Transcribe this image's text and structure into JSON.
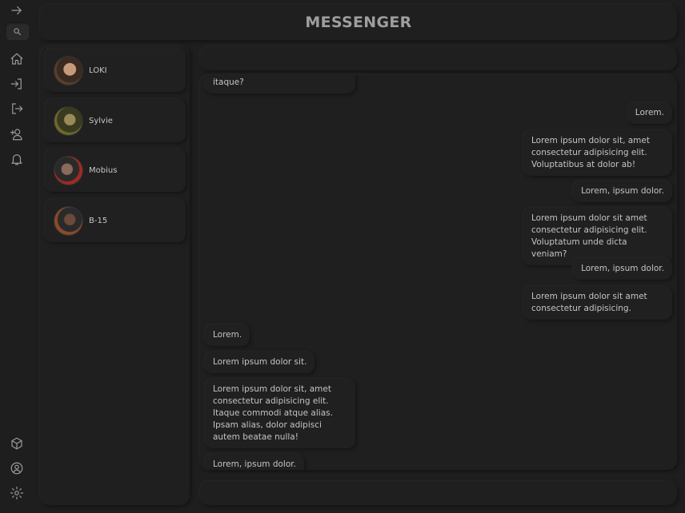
{
  "app": {
    "title": "MESSENGER"
  },
  "rail": {
    "icons": [
      "arrow-right-icon",
      "search-icon",
      "home-icon",
      "login-icon",
      "logout-icon",
      "add-user-icon",
      "bell-icon",
      "cube-icon",
      "user-circle-icon",
      "gear-icon"
    ]
  },
  "contacts": [
    {
      "name": "LOKI",
      "avatar_color": "#6b4a3a"
    },
    {
      "name": "Sylvie",
      "avatar_color": "#4a4a2a"
    },
    {
      "name": "Mobius",
      "avatar_color": "#5a2a22"
    },
    {
      "name": "B-15",
      "avatar_color": "#5a3a2a"
    }
  ],
  "messages": [
    {
      "side": "left",
      "text": "itaque?"
    },
    {
      "side": "right",
      "text": "Lorem."
    },
    {
      "side": "right",
      "text": "Lorem ipsum dolor sit, amet consectetur adipisicing elit. Voluptatibus at dolor ab!"
    },
    {
      "side": "right",
      "text": "Lorem, ipsum dolor."
    },
    {
      "side": "right",
      "text": "Lorem ipsum dolor sit amet consectetur adipisicing elit. Voluptatum unde dicta veniam?"
    },
    {
      "side": "right",
      "text": "Lorem, ipsum dolor."
    },
    {
      "side": "right",
      "text": "Lorem ipsum dolor sit amet consectetur adipisicing."
    },
    {
      "side": "left",
      "text": "Lorem."
    },
    {
      "side": "left",
      "text": "Lorem ipsum dolor sit."
    },
    {
      "side": "left",
      "text": "Lorem ipsum dolor sit, amet consectetur adipisicing elit. Itaque commodi atque alias. Ipsam alias, dolor adipisci autem beatae nulla!"
    },
    {
      "side": "left",
      "text": "Lorem, ipsum dolor."
    }
  ]
}
